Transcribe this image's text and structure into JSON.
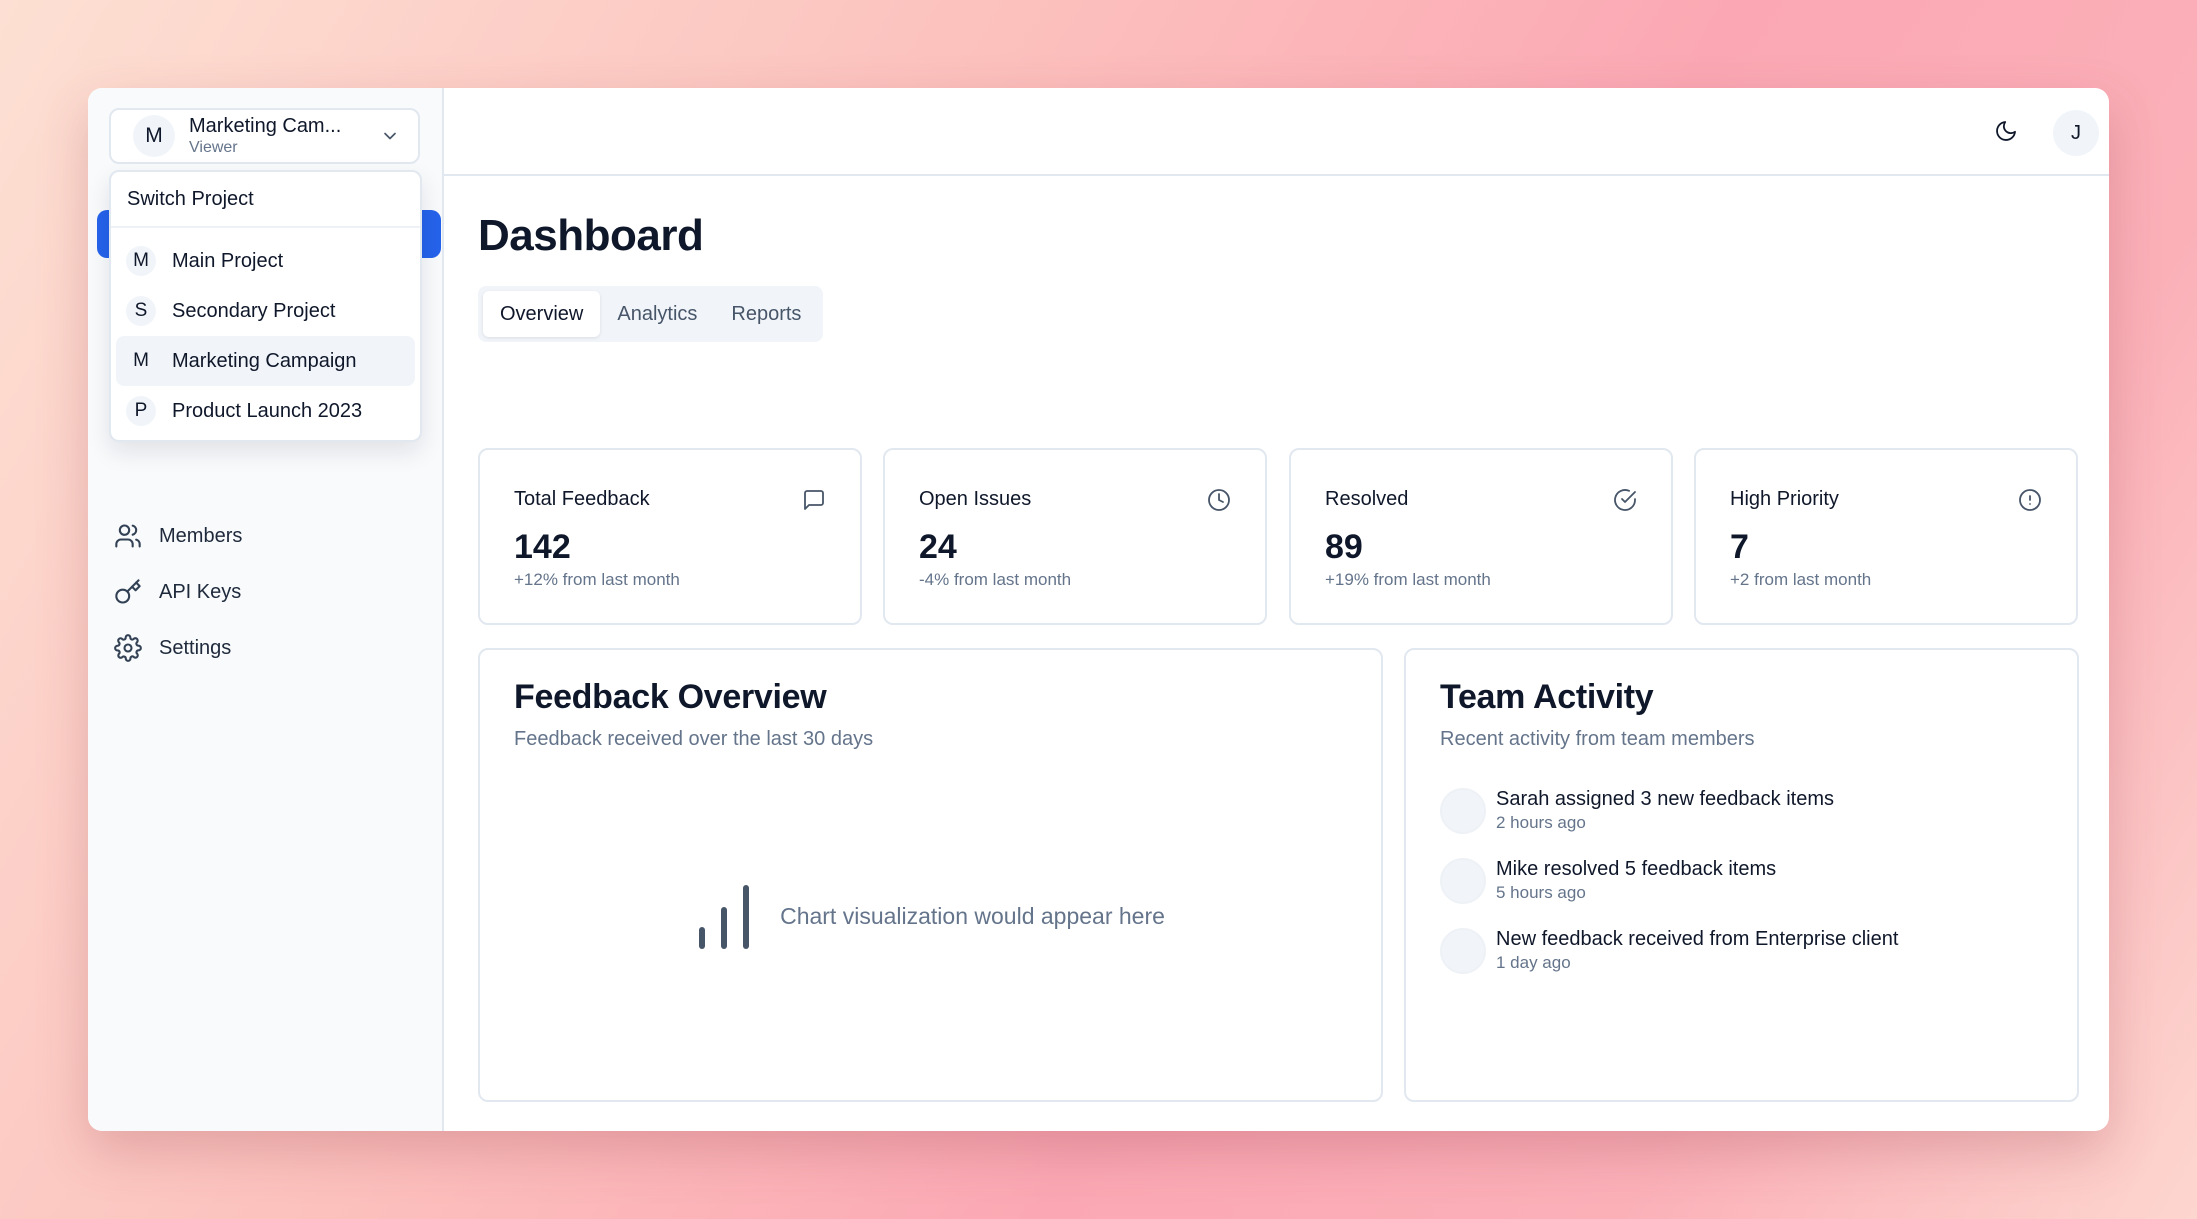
{
  "project_selector": {
    "avatar_letter": "M",
    "name": "Marketing Cam...",
    "role": "Viewer"
  },
  "project_menu": {
    "title": "Switch Project",
    "items": [
      {
        "letter": "M",
        "label": "Main Project"
      },
      {
        "letter": "S",
        "label": "Secondary Project"
      },
      {
        "letter": "M",
        "label": "Marketing Campaign",
        "active": true
      },
      {
        "letter": "P",
        "label": "Product Launch 2023"
      }
    ]
  },
  "sidebar": {
    "items": [
      {
        "label": "Members",
        "icon": "users-icon"
      },
      {
        "label": "API Keys",
        "icon": "key-icon"
      },
      {
        "label": "Settings",
        "icon": "gear-icon"
      }
    ]
  },
  "topbar": {
    "theme_icon": "moon-icon",
    "user_initial": "J"
  },
  "page": {
    "title": "Dashboard",
    "tabs": [
      {
        "label": "Overview",
        "active": true
      },
      {
        "label": "Analytics"
      },
      {
        "label": "Reports"
      }
    ]
  },
  "stats": [
    {
      "label": "Total Feedback",
      "value": "142",
      "change": "+12% from last month",
      "icon": "message-icon"
    },
    {
      "label": "Open Issues",
      "value": "24",
      "change": "-4% from last month",
      "icon": "clock-icon"
    },
    {
      "label": "Resolved",
      "value": "89",
      "change": "+19% from last month",
      "icon": "check-circle-icon"
    },
    {
      "label": "High Priority",
      "value": "7",
      "change": "+2 from last month",
      "icon": "alert-circle-icon"
    }
  ],
  "feedback_overview": {
    "title": "Feedback Overview",
    "subtitle": "Feedback received over the last 30 days",
    "placeholder": "Chart visualization would appear here"
  },
  "team_activity": {
    "title": "Team Activity",
    "subtitle": "Recent activity from team members",
    "items": [
      {
        "text": "Sarah assigned 3 new feedback items",
        "time": "2 hours ago"
      },
      {
        "text": "Mike resolved 5 feedback items",
        "time": "5 hours ago"
      },
      {
        "text": "New feedback received from Enterprise client",
        "time": "1 day ago"
      }
    ]
  },
  "colors": {
    "accent": "#2563eb",
    "border": "#e2e8f0",
    "muted": "#64748b"
  }
}
